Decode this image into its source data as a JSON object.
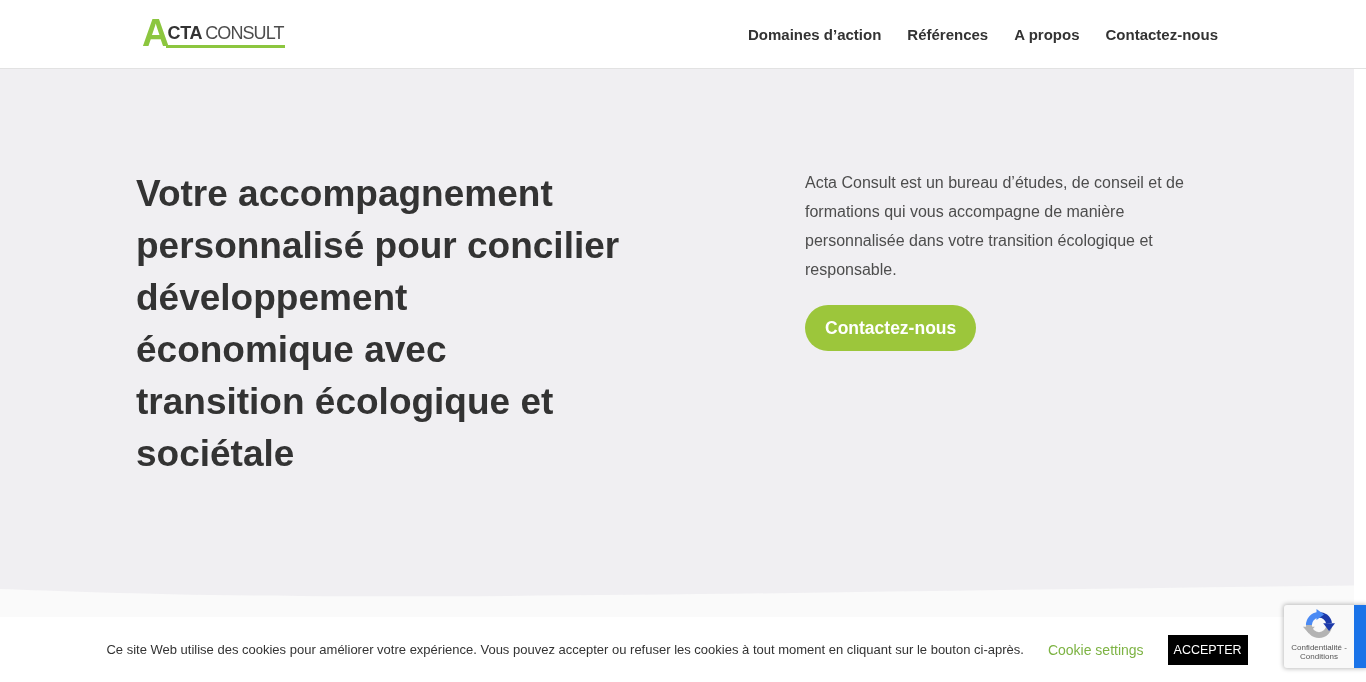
{
  "header": {
    "logo": {
      "initial": "A",
      "name": "CTA",
      "suffix": "CONSULT"
    },
    "nav": [
      "Domaines d’action",
      "Références",
      "A propos",
      "Contactez-nous"
    ]
  },
  "hero": {
    "heading": "Votre accompagnement personnalisé pour concilier développement économique avec transition écologique et sociétale",
    "description": "Acta Consult est un bureau d’études, de conseil et de formations qui vous accompagne de manière personnalisée dans votre transition écologique et responsable.",
    "button": "Contactez-nous"
  },
  "cookie_bar": {
    "message": "Ce site Web utilise des cookies pour améliorer votre expérience. Vous pouvez accepter ou refuser les cookies à tout moment en cliquant sur le bouton ci-après.",
    "settings_link": "Cookie settings",
    "accept_button": "ACCEPTER"
  },
  "captcha_badge": {
    "text": "Confidentialité - Conditions"
  }
}
